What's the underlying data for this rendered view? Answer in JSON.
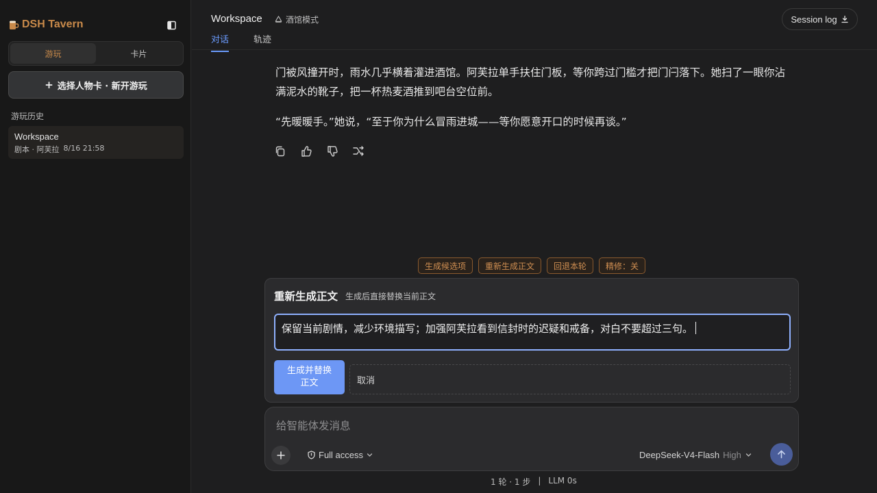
{
  "app": {
    "title": "DSH Tavern",
    "accent": "#c98a4a",
    "link_color": "#6b9cff"
  },
  "sidebar": {
    "segments": [
      {
        "label": "游玩",
        "active": true
      },
      {
        "label": "卡片",
        "active": false
      }
    ],
    "new_play_label": "选择人物卡 · 新开游玩",
    "history_label": "游玩历史",
    "history": [
      {
        "title": "Workspace",
        "meta": "剧本 · 阿芙拉",
        "time": "8/16 21:58"
      }
    ]
  },
  "header": {
    "title": "Workspace",
    "mode": "酒馆模式",
    "tabs": [
      {
        "label": "对话",
        "active": true
      },
      {
        "label": "轨迹",
        "active": false
      }
    ],
    "session_log": "Session log"
  },
  "story": {
    "paragraphs": [
      "门被风撞开时，雨水几乎横着灌进酒馆。阿芙拉单手扶住门板，等你跨过门槛才把门闩落下。她扫了一眼你沾满泥水的靴子，把一杯热麦酒推到吧台空位前。",
      "“先暖暖手。”她说，“至于你为什么冒雨进城——等你愿意开口的时候再谈。”"
    ]
  },
  "quick_actions": [
    "生成候选项",
    "重新生成正文",
    "回退本轮",
    "精修：关"
  ],
  "regen": {
    "title": "重新生成正文",
    "subtitle": "生成后直接替换当前正文",
    "input_value": "保留当前剧情，减少环境描写；加强阿芙拉看到信封时的迟疑和戒备，对白不要超过三句。",
    "primary_label": "生成并替换正文",
    "cancel_label": "取消"
  },
  "composer": {
    "placeholder": "给智能体发消息",
    "access": "Full access",
    "model": "DeepSeek-V4-Flash",
    "level": "High"
  },
  "footer": {
    "turns": "1 轮 · 1 步",
    "sep": "|",
    "llm": "LLM 0s"
  }
}
